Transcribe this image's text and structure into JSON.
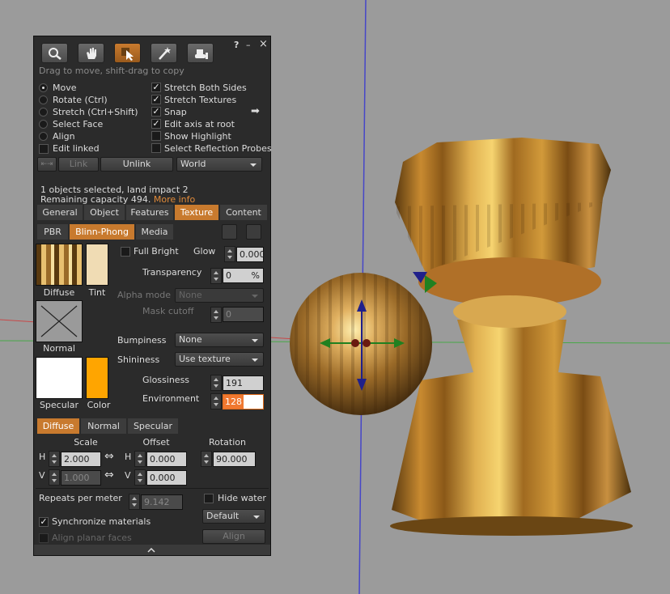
{
  "window": {
    "help_label": "?",
    "minimize_label": "–",
    "close_label": "×"
  },
  "toolbar": {
    "tools": [
      "focus",
      "grab",
      "edit",
      "create",
      "land"
    ],
    "hint": "Drag to move, shift-drag to copy"
  },
  "modes": {
    "move": "Move",
    "rotate": "Rotate (Ctrl)",
    "stretch": "Stretch (Ctrl+Shift)",
    "select_face": "Select Face",
    "align": "Align",
    "edit_linked": "Edit linked"
  },
  "options": {
    "stretch_both_sides": "Stretch Both Sides",
    "stretch_textures": "Stretch Textures",
    "snap": "Snap",
    "edit_axis_root": "Edit axis at root",
    "show_highlight": "Show Highlight",
    "select_reflection_probes": "Select Reflection Probes"
  },
  "link_row": {
    "link": "Link",
    "unlink": "Unlink",
    "grid": "World"
  },
  "selection": {
    "info": "1 objects selected, land impact 2",
    "capacity": "Remaining capacity 494.",
    "more_info": "More info"
  },
  "tabs": [
    "General",
    "Object",
    "Features",
    "Texture",
    "Content"
  ],
  "material_tabs": [
    "PBR",
    "Blinn-Phong",
    "Media"
  ],
  "texture": {
    "diffuse_label": "Diffuse",
    "tint_label": "Tint",
    "normal_label": "Normal",
    "specular_label": "Specular",
    "color_label": "Color",
    "full_bright": "Full Bright",
    "glow_label": "Glow",
    "glow_value": "0.000",
    "transparency_label": "Transparency",
    "transparency_value": "0",
    "transparency_unit": "%",
    "alpha_mode_label": "Alpha mode",
    "alpha_mode_value": "None",
    "mask_cutoff_label": "Mask cutoff",
    "mask_cutoff_value": "0",
    "bumpiness_label": "Bumpiness",
    "bumpiness_value": "None",
    "shininess_label": "Shininess",
    "shininess_value": "Use texture",
    "glossiness_label": "Glossiness",
    "glossiness_value": "191",
    "environment_label": "Environment",
    "environment_value": "128",
    "environment_fill": 0.5
  },
  "map_tabs": [
    "Diffuse",
    "Normal",
    "Specular"
  ],
  "mapping": {
    "scale_label": "Scale",
    "offset_label": "Offset",
    "rotation_label": "Rotation",
    "h_label": "H",
    "v_label": "V",
    "scale_h": "2.000",
    "scale_v": "1.000",
    "offset_h": "0.000",
    "offset_v": "0.000",
    "rotation": "90.000"
  },
  "bottom": {
    "repeats_label": "Repeats per meter",
    "repeats_value": "9.142",
    "hide_water": "Hide water",
    "default_dd": "Default",
    "sync_materials": "Synchronize materials",
    "align_planar": "Align planar faces",
    "align_button": "Align"
  },
  "colors": {
    "accent": "#c87a2e",
    "specular_color": "#ffa500",
    "tint_color": "#f0dcb4"
  }
}
